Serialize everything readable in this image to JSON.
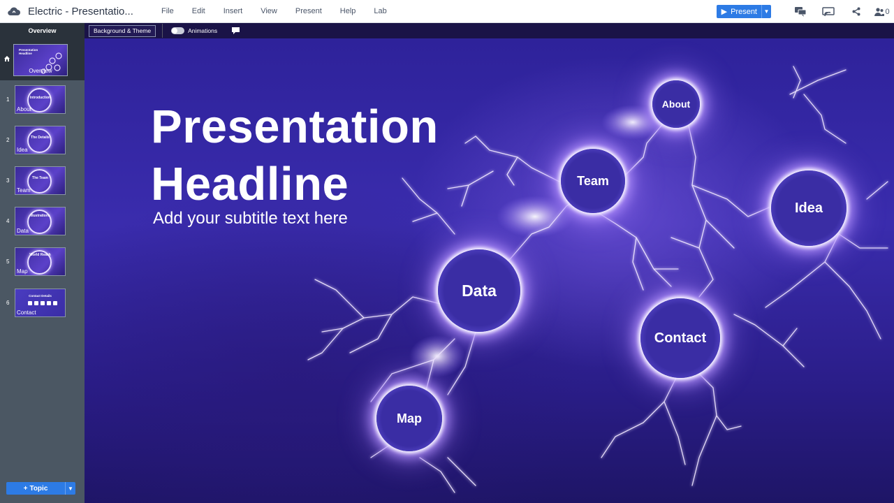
{
  "app": {
    "document_title": "Electric - Presentatio...",
    "menu": [
      "File",
      "Edit",
      "Insert",
      "View",
      "Present",
      "Help",
      "Lab"
    ],
    "present_label": "Present",
    "collaborator_count": "0"
  },
  "sidebar": {
    "header": "Overview",
    "overview_label": "Overview",
    "overview_thumb_title": "Presentation Headline",
    "slides": [
      {
        "number": "1",
        "label": "About",
        "thumb_title": "Introduction"
      },
      {
        "number": "2",
        "label": "Idea",
        "thumb_title": "The Details"
      },
      {
        "number": "3",
        "label": "Team",
        "thumb_title": "The Team"
      },
      {
        "number": "4",
        "label": "Data",
        "thumb_title": "Illustrations"
      },
      {
        "number": "5",
        "label": "Map",
        "thumb_title": "World Reach"
      },
      {
        "number": "6",
        "label": "Contact",
        "thumb_title": "Contact Details"
      }
    ],
    "add_topic_label": "Topic"
  },
  "toolbar": {
    "background_theme_label": "Background & Theme",
    "animations_label": "Animations"
  },
  "slide": {
    "headline_line1": "Presentation",
    "headline_line2": "Headline",
    "subtitle": "Add your subtitle text here",
    "nodes": {
      "about": "About",
      "team": "Team",
      "idea": "Idea",
      "data": "Data",
      "contact": "Contact",
      "map": "Map"
    }
  },
  "colors": {
    "accent": "#2d7be5",
    "sidebar": "#4b5763",
    "sidebar_dark": "#2a323b",
    "slide_background": "#3a2cad",
    "orb_glow": "#b694ff"
  }
}
